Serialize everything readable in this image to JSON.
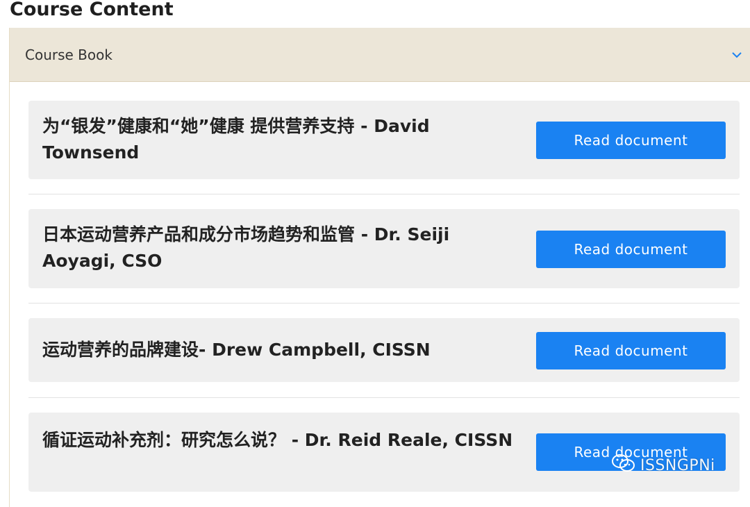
{
  "page_title": "Course Content",
  "accordion": {
    "title": "Course Book",
    "chevron_icon": "chevron-down-icon",
    "accent_color": "#1a82f2",
    "header_bg": "#ece6d8"
  },
  "documents": [
    {
      "title": "为“银发”健康和“她”健康 提供营养支持 - David Townsend",
      "button_label": "Read document"
    },
    {
      "title": "日本运动营养产品和成分市场趋势和监管 - Dr. Seiji Aoyagi, CSO",
      "button_label": "Read document"
    },
    {
      "title": "运动营养的品牌建设- Drew Campbell, CISSN",
      "button_label": "Read document"
    },
    {
      "title": "循证运动补充剂：研究怎么说？ - Dr. Reid Reale, CISSN",
      "button_label": "Read document"
    }
  ],
  "watermark": {
    "text": "ISSNGPNi",
    "icon": "wechat-icon"
  }
}
